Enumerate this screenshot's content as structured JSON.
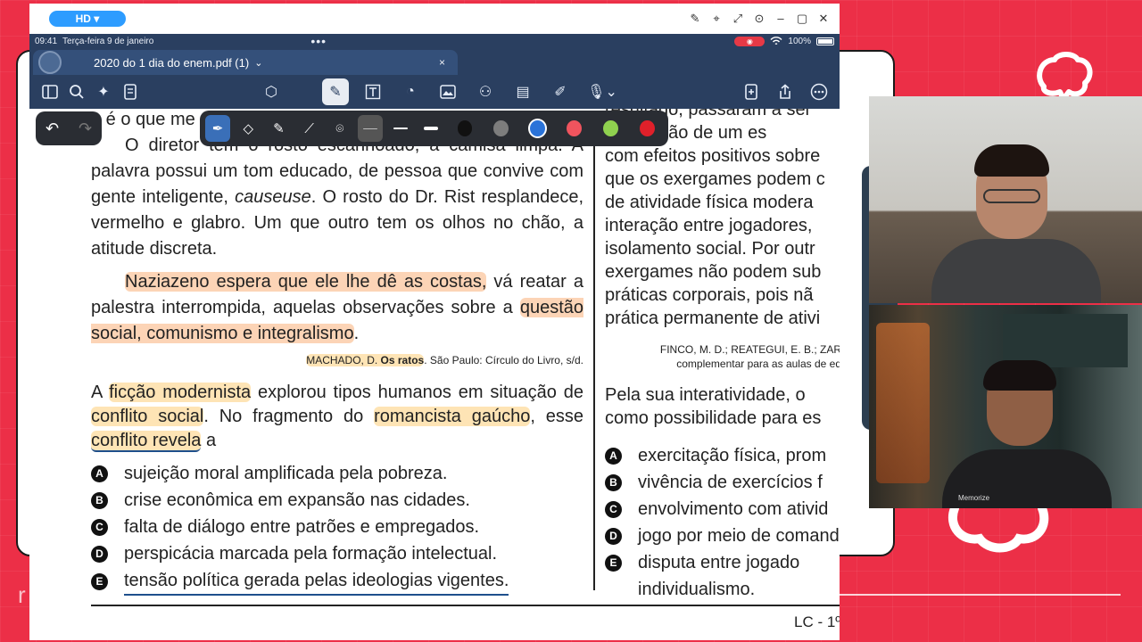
{
  "window": {
    "quality_badge": "HD ▾",
    "controls": [
      "✎",
      "⌖",
      "⤢",
      "⊙",
      "–",
      "▢",
      "✕"
    ]
  },
  "statusbar": {
    "time": "09:41",
    "date": "Terça-feira 9 de janeiro",
    "dots": "•••",
    "battery": "100%"
  },
  "tab": {
    "title": "2020 do 1 dia do enem.pdf (1)",
    "caret": "⌄",
    "close": "×"
  },
  "toolbar": {
    "left_icons": [
      "sidebar-icon",
      "search-icon",
      "sparkle-icon",
      "document-icon"
    ],
    "center_icons": [
      "lasso-icon",
      "pen-icon",
      "text-box-icon",
      "shape-icon",
      "image-icon",
      "stamp-icon",
      "sticky-note-icon",
      "eraser-icon",
      "mic-icon"
    ],
    "right_icons": [
      "add-page-icon",
      "share-icon",
      "more-icon"
    ]
  },
  "palette": {
    "undo": "↶",
    "redo": "↷",
    "colors": [
      "#111111",
      "#7d7d7d",
      "#2a73d9",
      "#f0545e",
      "#8fd14f",
      "#e0202a"
    ],
    "selected_color": "#2a73d9"
  },
  "doc": {
    "left": {
      "top_fragment": "e é o que me",
      "top_fragment_rest": "...",
      "para1": "O diretor tem o rosto escanhoado, a camisa limpa. A palavra possui um tom educado, de pessoa que convive com gente inteligente, ",
      "para1_italic": "causeuse",
      "para1_end": ". O rosto do Dr. Rist resplandece, vermelho e glabro. Um que outro tem os olhos no chão, a atitude discreta.",
      "para2_hl": "Naziazeno espera que ele lhe dê as costas,",
      "para2_mid": " vá reatar a palestra interrompida, aquelas observações sobre a ",
      "para2_hl2": "questão social, comunismo e integralismo",
      "para2_end": ".",
      "source_author": "MACHADO, D. ",
      "source_title": "Os ratos",
      "source_rest": ". São Paulo: Círculo do Livro, s/d.",
      "question_a": "A ",
      "question_hl1": "ficção modernista",
      "question_b": " explorou tipos humanos em situação de ",
      "question_hl2": "conflito social",
      "question_c": ". No fragmento do ",
      "question_hl3": "romancista gaúcho",
      "question_d": ", esse ",
      "question_hl4": "conflito revela",
      "question_e": " a",
      "options": [
        {
          "letter": "A",
          "text": "sujeição moral amplificada pela pobreza."
        },
        {
          "letter": "B",
          "text": "crise econômica em expansão nas cidades."
        },
        {
          "letter": "C",
          "text": "falta de diálogo entre patrões e empregados."
        },
        {
          "letter": "D",
          "text": "perspicácia marcada pela formação intelectual."
        },
        {
          "letter": "E",
          "text": "tensão política gerada pelas ideologias vigentes."
        }
      ]
    },
    "right": {
      "lines": [
        "resultado, passaram a ser",
        "na adoção de um es",
        "com efeitos positivos sobre",
        "que os exergames podem c",
        "de atividade física modera",
        "interação entre jogadores,",
        "isolamento social. Por outr",
        "exergames não podem sub",
        "práticas corporais, pois nã",
        "prática permanente de ativi"
      ],
      "ref1": "FINCO, M. D.; REATEGUI, E. B.; ZAR",
      "ref2": "complementar para as aulas de ed",
      "question": [
        "Pela sua interatividade, o",
        "como possibilidade para es"
      ],
      "options": [
        {
          "letter": "A",
          "text": "exercitação física, prom"
        },
        {
          "letter": "B",
          "text": "vivência de exercícios f"
        },
        {
          "letter": "C",
          "text": "envolvimento com ativid"
        },
        {
          "letter": "D",
          "text": "jogo por meio de comand"
        },
        {
          "letter": "E",
          "text": "disputa entre jogado"
        }
      ],
      "option_e_cont": "individualismo."
    },
    "footer": "LC - 1º"
  },
  "cams": {
    "shirt_text": "Memorize"
  }
}
